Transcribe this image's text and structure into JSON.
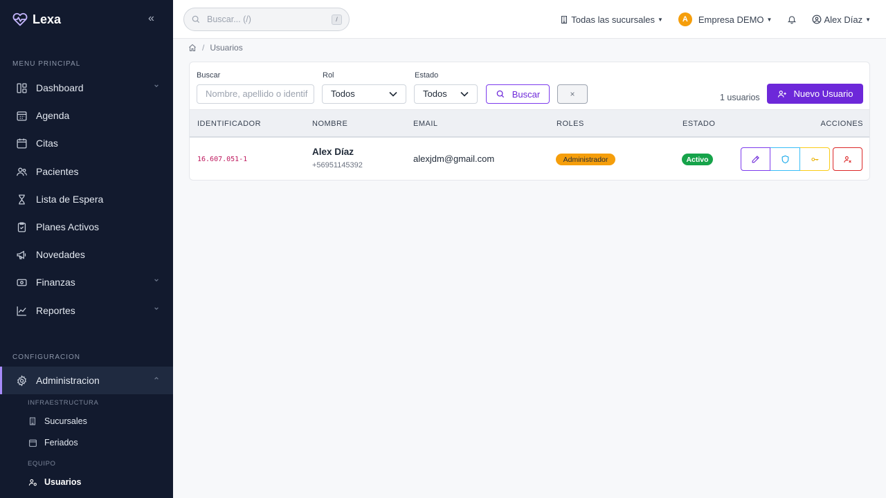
{
  "app": {
    "name": "Lexa"
  },
  "sidebar": {
    "section_main": "MENU PRINCIPAL",
    "items": [
      {
        "label": "Dashboard",
        "icon": "dashboard-icon",
        "has_chevron": true
      },
      {
        "label": "Agenda",
        "icon": "calendar-grid-icon"
      },
      {
        "label": "Citas",
        "icon": "calendar-icon"
      },
      {
        "label": "Pacientes",
        "icon": "users-icon"
      },
      {
        "label": "Lista de Espera",
        "icon": "hourglass-icon"
      },
      {
        "label": "Planes Activos",
        "icon": "clipboard-check-icon"
      },
      {
        "label": "Novedades",
        "icon": "megaphone-icon"
      },
      {
        "label": "Finanzas",
        "icon": "cash-icon",
        "has_chevron": true
      },
      {
        "label": "Reportes",
        "icon": "chart-line-icon",
        "has_chevron": true
      }
    ],
    "section_config": "CONFIGURACION",
    "admin": {
      "label": "Administracion",
      "icon": "gear-icon"
    },
    "infra_label": "INFRAESTRUCTURA",
    "infra_items": [
      {
        "label": "Sucursales",
        "icon": "building-icon"
      },
      {
        "label": "Feriados",
        "icon": "calendar-icon"
      }
    ],
    "equipo_label": "EQUIPO",
    "equipo_items": [
      {
        "label": "Usuarios",
        "icon": "users-gear-icon",
        "active": true
      }
    ]
  },
  "topbar": {
    "search_placeholder": "Buscar... (/)",
    "search_shortcut": "/",
    "branches": "Todas las sucursales",
    "company_initial": "A",
    "company": "Empresa DEMO",
    "user": "Alex Díaz"
  },
  "breadcrumb": {
    "current": "Usuarios"
  },
  "filters": {
    "search_label": "Buscar",
    "search_placeholder": "Nombre, apellido o identif",
    "role_label": "Rol",
    "role_value": "Todos",
    "status_label": "Estado",
    "status_value": "Todos",
    "search_button": "Buscar",
    "clear_button": "×",
    "count": "1 usuarios",
    "new_button": "Nuevo Usuario"
  },
  "table": {
    "headers": {
      "id": "IDENTIFICADOR",
      "name": "NOMBRE",
      "email": "EMAIL",
      "roles": "ROLES",
      "status": "ESTADO",
      "actions": "ACCIONES"
    },
    "rows": [
      {
        "id": "16.607.051-1",
        "name": "Alex Díaz",
        "phone": "+56951145392",
        "email": "alexjdm@gmail.com",
        "role": "Administrador",
        "status": "Activo"
      }
    ]
  },
  "colors": {
    "sidebar_bg": "#121a2e",
    "accent": "#6d28d9",
    "role_badge": "#f59e0b",
    "status_badge": "#16a34a"
  }
}
